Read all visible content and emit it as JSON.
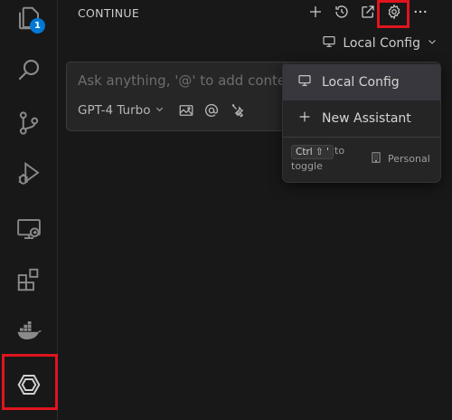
{
  "activity_bar": {
    "explorer_badge": "1",
    "items": [
      "files-icon",
      "search-icon",
      "source-control-icon",
      "run-debug-icon",
      "remote-explorer-icon",
      "extensions-icon",
      "docker-icon",
      "continue-icon"
    ]
  },
  "panel": {
    "title": "CONTINUE",
    "toolbar": [
      "add-icon",
      "history-icon",
      "open-external-icon",
      "gear-icon",
      "more-icon"
    ],
    "config_selector": "Local Config"
  },
  "input": {
    "placeholder": "Ask anything, '@' to add context",
    "model": "GPT-4 Turbo"
  },
  "dropdown": {
    "items": [
      {
        "label": "Local Config",
        "icon": "monitor-icon"
      },
      {
        "label": "New Assistant",
        "icon": "plus-icon"
      }
    ],
    "shortcut": "Ctrl ⇧ '",
    "shortcut_to": "to",
    "shortcut_toggle": "toggle",
    "personal": "Personal"
  },
  "colors": {
    "highlight": "#e0141e",
    "badge": "#0078d4",
    "background": "#181818"
  }
}
